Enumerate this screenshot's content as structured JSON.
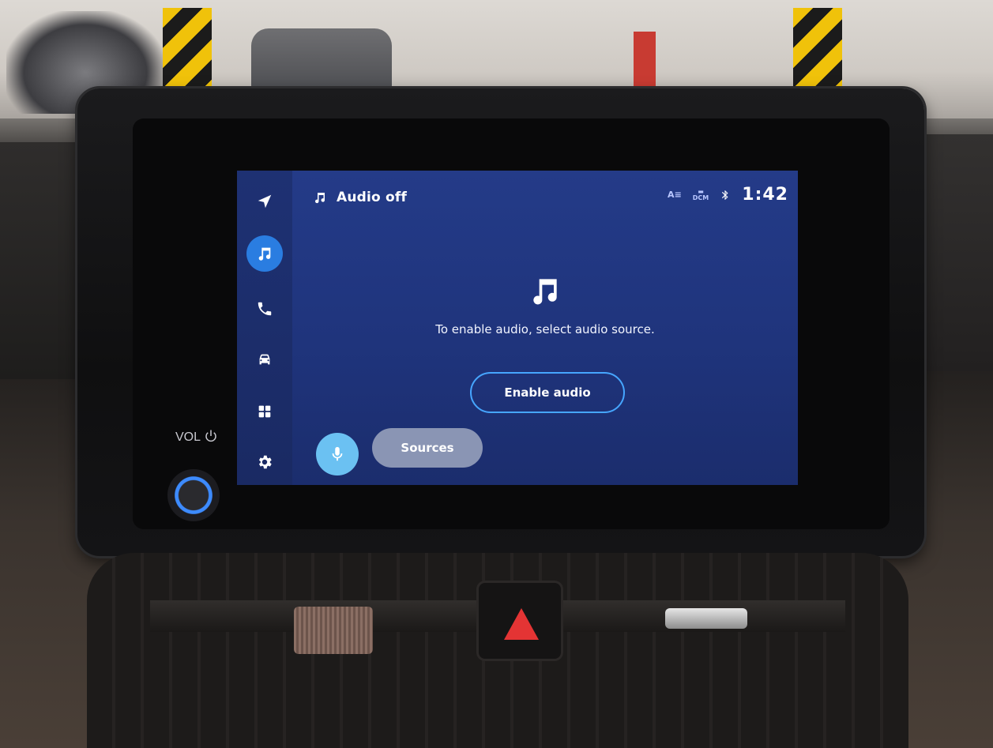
{
  "header": {
    "title": "Audio off",
    "status_icons": [
      "language-icon",
      "dcm-icon",
      "bluetooth-icon"
    ],
    "status_text_1": "A",
    "status_text_2": "DCM",
    "time": "1:42"
  },
  "rail": {
    "items": [
      {
        "id": "navigation",
        "icon": "navigation-arrow-icon",
        "active": false
      },
      {
        "id": "audio",
        "icon": "music-note-icon",
        "active": true
      },
      {
        "id": "phone",
        "icon": "phone-icon",
        "active": false
      },
      {
        "id": "vehicle",
        "icon": "car-icon",
        "active": false
      },
      {
        "id": "apps",
        "icon": "apps-grid-icon",
        "active": false
      },
      {
        "id": "settings",
        "icon": "gear-icon",
        "active": false
      }
    ]
  },
  "main": {
    "message": "To enable audio, select audio source.",
    "enable_button_label": "Enable audio"
  },
  "bottom": {
    "mic_icon": "microphone-icon",
    "sources_label": "Sources"
  },
  "hardware": {
    "vol_label": "VOL"
  },
  "colors": {
    "screen_bg": "#243b88",
    "accent": "#2a7de1",
    "button_border": "#46a6ff",
    "mic_bg": "#6bc1f2",
    "sources_bg": "#8a95b4"
  }
}
